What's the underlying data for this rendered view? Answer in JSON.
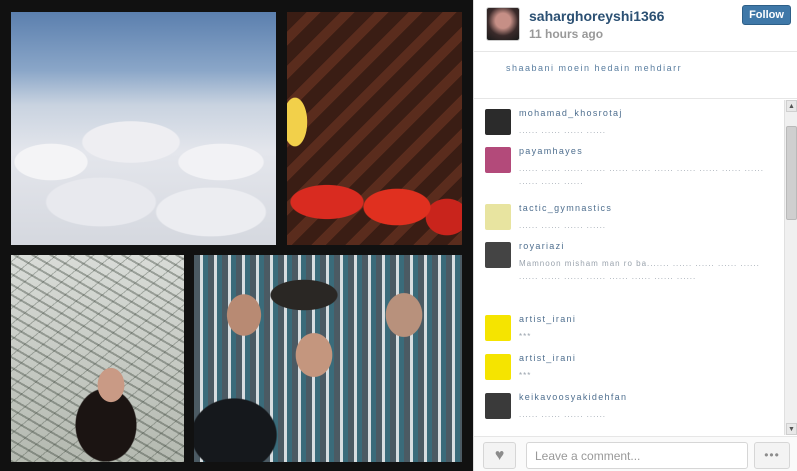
{
  "post": {
    "username": "saharghoreyshi1366",
    "timestamp": "11 hours ago",
    "follow_label": "Follow",
    "likes_text": "shaabani  moein  hedain  mehdiarr"
  },
  "comments": [
    {
      "user": "mohamad_khosrotaj",
      "text": "...... ...... ...... ......",
      "avatar_color": "#2b2b2b"
    },
    {
      "user": "payamhayes",
      "text": "...... ...... ...... ...... ...... ...... ...... ...... ...... ...... ...... ...... ...... ......",
      "avatar_color": "#b34a7a"
    },
    {
      "user": "tactic_gymnastics",
      "text": "...... ...... ...... ......",
      "avatar_color": "#e8e4a0"
    },
    {
      "user": "royariazi",
      "text": "Mamnoon misham man ro ba....... ...... ...... ...... ...... ...... ...... ...... ...... ...... ...... ...... ......",
      "avatar_color": "#444444"
    },
    {
      "user": "artist_irani",
      "text": "***",
      "avatar_color": "#f5e400"
    },
    {
      "user": "artist_irani",
      "text": "***",
      "avatar_color": "#f5e400"
    },
    {
      "user": "keikavoosyakidehfan",
      "text": "...... ...... ...... ......",
      "avatar_color": "#3a3a3a"
    }
  ],
  "footer": {
    "comment_placeholder": "Leave a comment...",
    "more_label": "•••",
    "heart_icon": "♥"
  },
  "colors": {
    "username": "#2b5073",
    "follow_bg": "#3f78a8",
    "comment_user": "#4f6f8f"
  }
}
